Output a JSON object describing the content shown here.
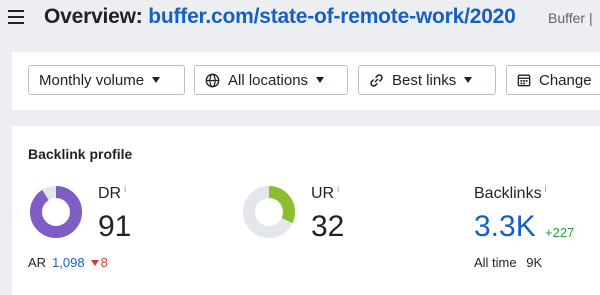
{
  "header": {
    "title_prefix": "Overview: ",
    "url": "buffer.com/state-of-remote-work/2020",
    "extra": "Buffer |"
  },
  "filters": {
    "volume": "Monthly volume",
    "locations": "All locations",
    "links": "Best links",
    "change": "Change"
  },
  "backlink_profile": {
    "title": "Backlink profile",
    "dr": {
      "label": "DR",
      "info": "i",
      "value": "91",
      "fill_fraction": 0.91,
      "color": "#7e5dc4"
    },
    "ur": {
      "label": "UR",
      "info": "i",
      "value": "32",
      "fill_fraction": 0.32,
      "color": "#8cbf2f"
    },
    "ar": {
      "label": "AR",
      "value": "1,098",
      "delta": "8"
    },
    "backlinks": {
      "label": "Backlinks",
      "info": "i",
      "value": "3.3K",
      "delta": "+227",
      "all_time_label": "All time",
      "all_time_value": "9K"
    }
  },
  "colors": {
    "accent": "#1760c3",
    "track": "#e3e6ea",
    "up": "#2a9d3f",
    "down": "#d23b2f"
  }
}
